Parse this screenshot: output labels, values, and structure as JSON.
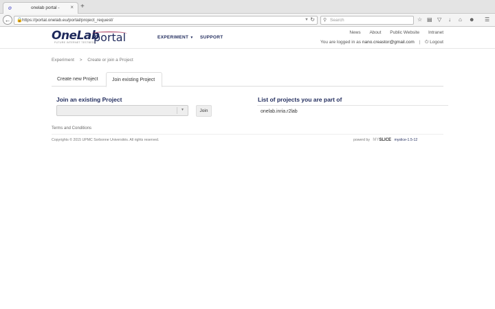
{
  "browser": {
    "tab_title": "onelab portal -",
    "tab_favicon": "o",
    "tab_close": "×",
    "new_tab": "+",
    "url": "https://portal.onelab.eu/portal/project_request/",
    "search_placeholder": "Search",
    "icons": [
      "star-icon",
      "reading-list-icon",
      "pocket-icon",
      "download-icon",
      "home-icon",
      "chat-icon",
      "menu-icon"
    ]
  },
  "header": {
    "logo_main": "OneLab",
    "logo_sub": "portal",
    "logo_tagline": "FUTURE INTERNET TESTBEDS",
    "nav": [
      {
        "label": "EXPERIMENT",
        "has_dropdown": true
      },
      {
        "label": "SUPPORT",
        "has_dropdown": false
      }
    ],
    "util_links": [
      "News",
      "About",
      "Public Website",
      "Intranet"
    ],
    "logged_in_prefix": "You are logged in as",
    "user_email": "nano.creastor@gmail.com",
    "logout_label": "Logout"
  },
  "breadcrumb": {
    "root": "Experiment",
    "separator": ">",
    "current": "Create or join a Project"
  },
  "tabs": [
    {
      "label": "Create new Project",
      "active": false
    },
    {
      "label": "Join existing Project",
      "active": true
    }
  ],
  "join_section": {
    "title": "Join an existing Project",
    "select_value": "",
    "join_button": "Join"
  },
  "projects_section": {
    "title": "List of projects you are part of",
    "projects": [
      "onelab.inria.r2lab"
    ]
  },
  "footer": {
    "terms": "Terms and Conditions",
    "copyright": "Copyrights © 2015 UPMC Sorbonne Universités. All rights reserved.",
    "powered_by": "powerd by",
    "brand_prefix": "MY",
    "brand": "SLICE",
    "version": "myslice-1.5-12"
  },
  "colors": {
    "brand_navy": "#1f2a5c",
    "brand_accent": "#a0224a"
  }
}
